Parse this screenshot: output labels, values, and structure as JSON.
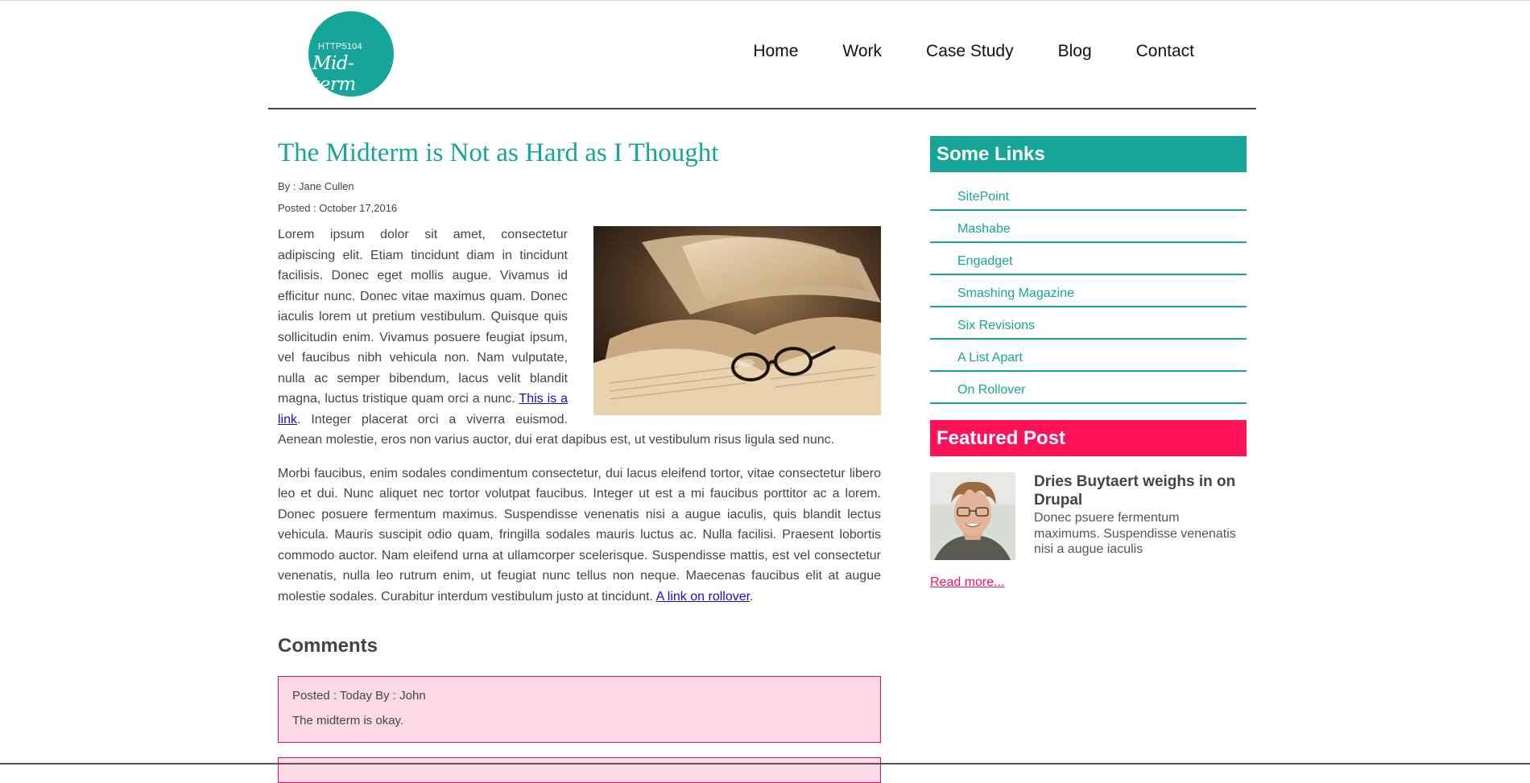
{
  "logo": {
    "small_text": "HTTP5104",
    "big_text": "Mid-term"
  },
  "nav": [
    "Home",
    "Work",
    "Case Study",
    "Blog",
    "Contact"
  ],
  "post": {
    "title": "The Midterm is Not as Hard as I Thought",
    "author": "By : Jane Cullen",
    "posted": "Posted : October 17,2016",
    "p1_text_a": "Lorem ipsum dolor sit amet, consectetur adipiscing elit. Etiam tincidunt diam in tincidunt facilisis. Donec eget mollis augue. Vivamus id efficitur nunc. Donec vitae maximus quam. Donec iaculis lorem ut pretium vestibulum. Quisque quis sollicitudin enim. Vivamus posuere feugiat ipsum, vel faucibus nibh vehicula non. Nam vulputate, nulla ac semper bibendum, lacus velit blandit magna, luctus tristique quam orci a nunc. ",
    "p1_link": "This is a link",
    "p1_text_b": ". Integer placerat orci a viverra euismod. Aenean molestie, eros non varius auctor, dui erat dapibus est, ut vestibulum risus ligula sed nunc.",
    "p2_text": "Morbi faucibus, enim sodales condimentum consectetur, dui lacus eleifend tortor, vitae consectetur libero leo et dui. Nunc aliquet nec tortor volutpat faucibus. Integer ut est a mi faucibus porttitor ac a lorem. Donec posuere fermentum maximus. Suspendisse venenatis nisi a augue iaculis, quis blandit lectus vehicula. Mauris suscipit odio quam, fringilla sodales mauris luctus ac. Nulla facilisi. Praesent lobortis commodo auctor. Nam eleifend urna at ullamcorper scelerisque. Suspendisse mattis, est vel consectetur venenatis, nulla leo rutrum enim, ut feugiat nunc tellus non neque. Maecenas faucibus elit at augue molestie sodales. Curabitur interdum vestibulum justo at tincidunt. ",
    "p2_link": "A link on rollover",
    "p2_end": "."
  },
  "comments": {
    "heading": "Comments",
    "items": [
      {
        "meta": "Posted : Today By : John",
        "text": "The midterm is okay."
      }
    ]
  },
  "sidebar": {
    "links_heading": "Some Links",
    "links": [
      "SitePoint",
      "Mashabe",
      "Engadget",
      "Smashing Magazine",
      "Six Revisions",
      "A List Apart",
      "On Rollover"
    ],
    "featured_heading": "Featured Post",
    "featured": {
      "title": "Dries Buytaert weighs in on Drupal",
      "text": "Donec psuere fermentum maximums. Suspendisse venenatis nisi a augue iaculis",
      "read_more": "Read more..."
    }
  },
  "colors": {
    "accent": "#17a59a",
    "pink": "#ff1258",
    "link": "#1a0dcc",
    "comment_bg": "#fdd9e5"
  }
}
